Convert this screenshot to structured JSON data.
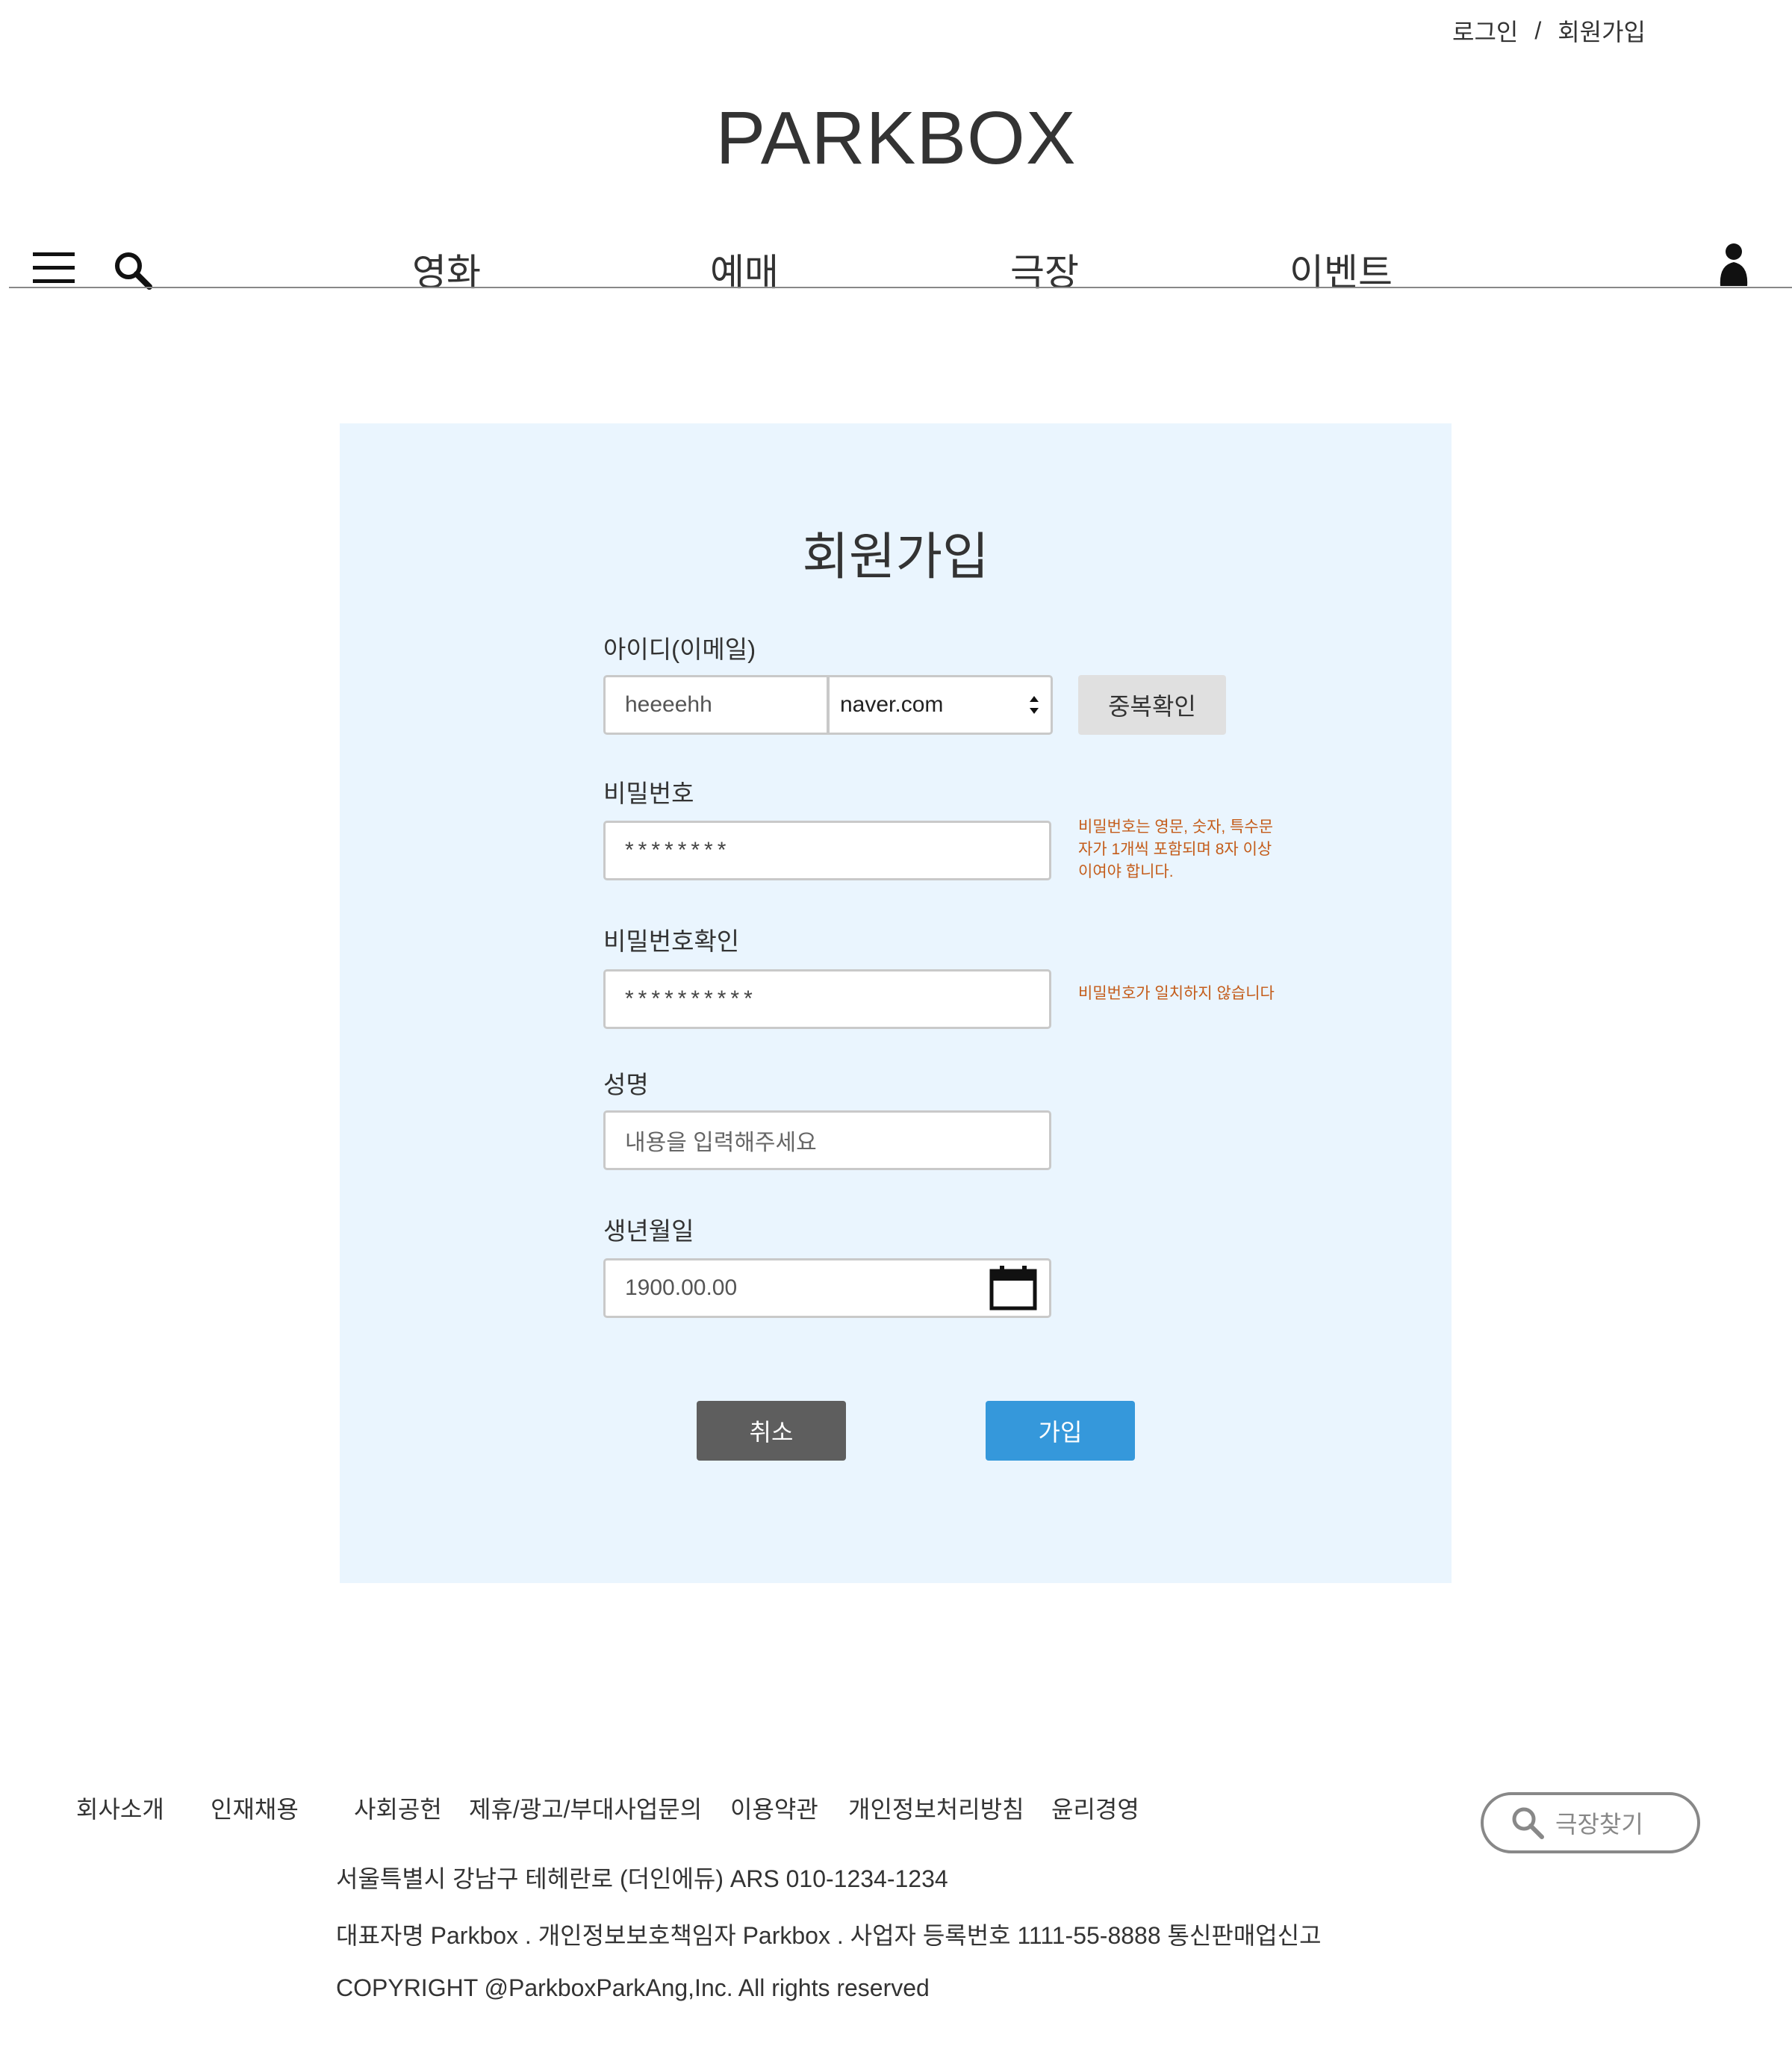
{
  "header": {
    "login_label": "로그인",
    "separator": "/",
    "signup_label": "회원가입",
    "brand": "PARKBOX",
    "nav": [
      "영화",
      "예매",
      "극장",
      "이벤트"
    ],
    "icons": [
      "menu-icon",
      "search-icon",
      "user-icon"
    ]
  },
  "form": {
    "title": "회원가입",
    "id": {
      "label": "아이디(이메일)",
      "value": "heeeehh",
      "domain_selected": "naver.com",
      "check_button": "중복확인"
    },
    "password": {
      "label": "비밀번호",
      "value": "********",
      "hint_lines": [
        "비밀번호는 영문, 숫자, 특수문",
        "자가 1개씩 포함되며 8자 이상",
        "이여야 합니다."
      ]
    },
    "password_confirm": {
      "label": "비밀번호확인",
      "value": "**********",
      "hint": "비밀번호가 일치하지 않습니다"
    },
    "name": {
      "label": "성명",
      "placeholder": "내용을 입력해주세요"
    },
    "birthdate": {
      "label": "생년월일",
      "value": "1900.00.00",
      "icon": "calendar-icon"
    },
    "cancel_button": "취소",
    "submit_button": "가입"
  },
  "footer": {
    "links": [
      "회사소개",
      "인재채용",
      "사회공헌",
      "제휴/광고/부대사업문의",
      "이용약관",
      "개인정보처리방침",
      "윤리경영"
    ],
    "address": "서울특별시 강남구 테헤란로 (더인에듀) ARS 010-1234-1234",
    "representative": "대표자명 Parkbox . 개인정보보호책임자 Parkbox . 사업자 등록번호 1111-55-8888 통신판매업신고",
    "copyright": "COPYRIGHT @ParkboxParkAng,Inc. All rights reserved",
    "theater_search_label": "극장찾기"
  },
  "colors": {
    "panel_bg": "#eaf5fe",
    "primary": "#3598db",
    "cancel": "#5e5e5e",
    "check_button": "#e0e0e0",
    "hint": "#c45c1a"
  }
}
